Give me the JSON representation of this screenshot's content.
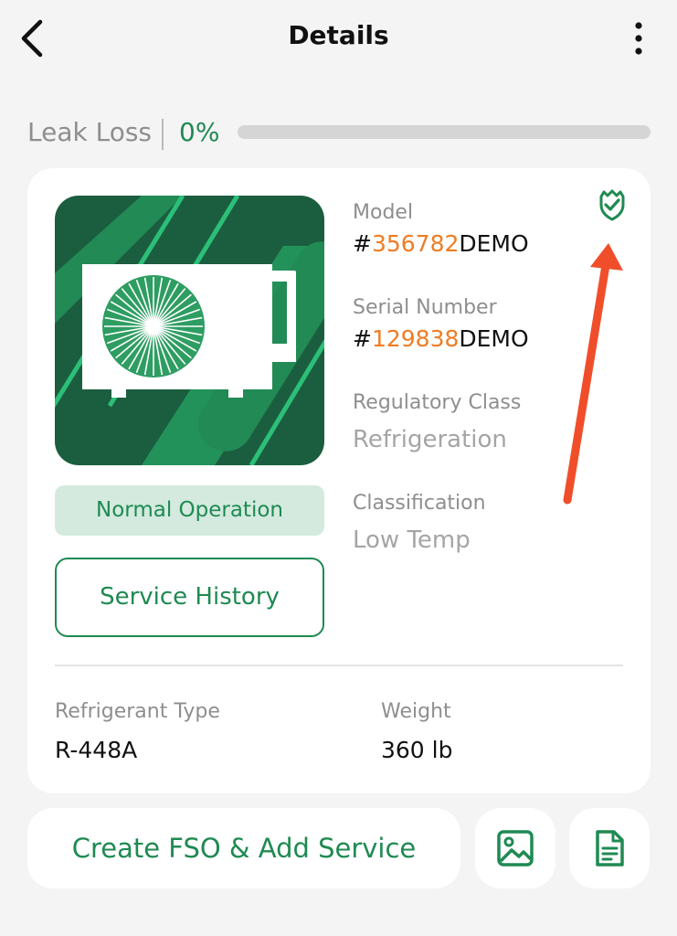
{
  "header": {
    "title": "Details"
  },
  "leak": {
    "label": "Leak Loss",
    "value": "0%",
    "progress_percent": 0
  },
  "unit": {
    "status": "Normal Operation",
    "service_history_label": "Service History",
    "model_label": "Model",
    "model_prefix": "#",
    "model_number": "356782",
    "model_suffix": "DEMO",
    "serial_label": "Serial Number",
    "serial_prefix": "#",
    "serial_number": "129838",
    "serial_suffix": "DEMO",
    "regulatory_label": "Regulatory Class",
    "regulatory_value": "Refrigeration",
    "classification_label": "Classification",
    "classification_value": "Low Temp"
  },
  "specs": {
    "refrigerant_label": "Refrigerant Type",
    "refrigerant_value": "R-448A",
    "weight_label": "Weight",
    "weight_value": "360 lb"
  },
  "actions": {
    "create_label": "Create FSO & Add Service"
  },
  "icons": {
    "back": "chevron-left-icon",
    "more": "vertical-ellipsis-icon",
    "verified": "shield-check-icon",
    "image": "image-icon",
    "document": "document-icon"
  },
  "colors": {
    "brand_green": "#1f8a52",
    "dark_green": "#1b5e3f",
    "accent_orange": "#f07c23",
    "annotation_red": "#f04e2a",
    "status_bg": "#d4eadf"
  }
}
